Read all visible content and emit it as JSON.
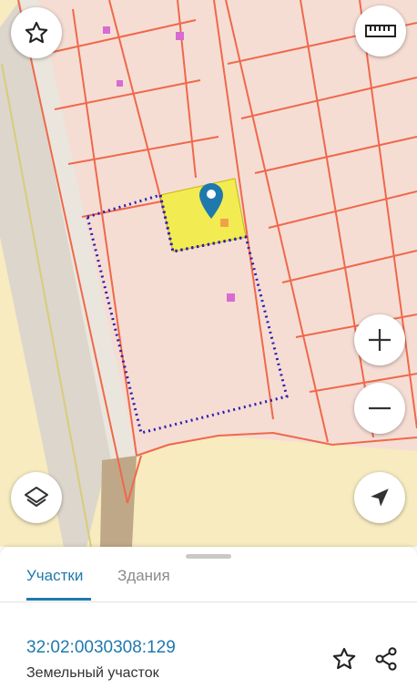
{
  "map": {
    "controls": {
      "favorite": "star-icon",
      "ruler": "ruler-icon",
      "zoom_in": "plus-icon",
      "zoom_out": "minus-icon",
      "layers": "layers-icon",
      "locate": "navigation-arrow-icon"
    },
    "colors": {
      "parcel_fill": "#f5ddd4",
      "parcel_lines": "#f0684a",
      "selected_parcel": "#f2ec52",
      "boundary": "#2a1fb0",
      "pin": "#1f79ad",
      "marker": "#d86bd1"
    }
  },
  "sheet": {
    "tabs": [
      {
        "label": "Участки",
        "active": true
      },
      {
        "label": "Здания",
        "active": false
      }
    ],
    "property": {
      "cadastral_number": "32:02:0030308:129",
      "type": "Земельный участок"
    },
    "actions": {
      "favorite": "star-icon",
      "share": "share-icon"
    },
    "accent_color": "#1f79ad"
  }
}
